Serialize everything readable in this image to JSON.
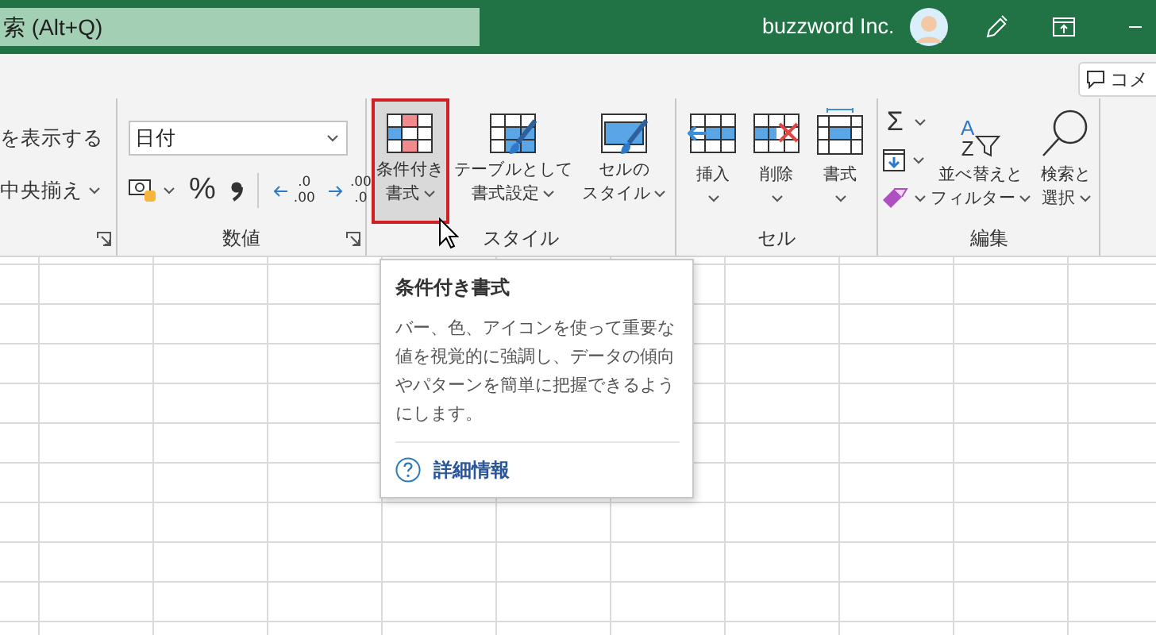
{
  "title_bar": {
    "search_text": "索 (Alt+Q)",
    "account_name": "buzzword Inc."
  },
  "comment_button": {
    "label": "コメ"
  },
  "ribbon": {
    "alignment_group": {
      "items": [
        {
          "label": "を表示する"
        },
        {
          "label": "中央揃え",
          "dropdown": true
        }
      ]
    },
    "number_group": {
      "label": "数値",
      "format_box": {
        "value": "日付"
      },
      "percent": "%",
      "increase_decimal": {
        "top": ".0",
        "bottom": ".00"
      },
      "decrease_decimal": {
        "top": ".00",
        "bottom": ".0"
      }
    },
    "styles_group": {
      "label": "スタイル",
      "buttons": [
        {
          "kind": "conditional",
          "lines": [
            "条件付き",
            "書式"
          ],
          "selected": true
        },
        {
          "kind": "table",
          "lines": [
            "テーブルとして",
            "書式設定"
          ],
          "selected": false
        },
        {
          "kind": "cellstyle",
          "lines": [
            "セルの",
            "スタイル"
          ],
          "selected": false
        }
      ]
    },
    "cells_group": {
      "label": "セル",
      "buttons": [
        {
          "kind": "insert",
          "label": "挿入"
        },
        {
          "kind": "delete",
          "label": "削除"
        },
        {
          "kind": "format",
          "label": "書式"
        }
      ]
    },
    "editing_group": {
      "label": "編集",
      "small_buttons": [
        {
          "kind": "sum",
          "symbol": "Σ"
        },
        {
          "kind": "fill"
        },
        {
          "kind": "clear"
        }
      ],
      "large_buttons": [
        {
          "kind": "sort",
          "letters": [
            "A",
            "Z"
          ],
          "lines": [
            "並べ替えと",
            "フィルター"
          ]
        },
        {
          "kind": "find",
          "lines": [
            "検索と",
            "選択"
          ]
        }
      ]
    }
  },
  "tooltip": {
    "title": "条件付き書式",
    "body": "バー、色、アイコンを使って重要な値を視覚的に強調し、データの傾向やパターンを簡単に把握できるようにします。",
    "link": "詳細情報"
  }
}
